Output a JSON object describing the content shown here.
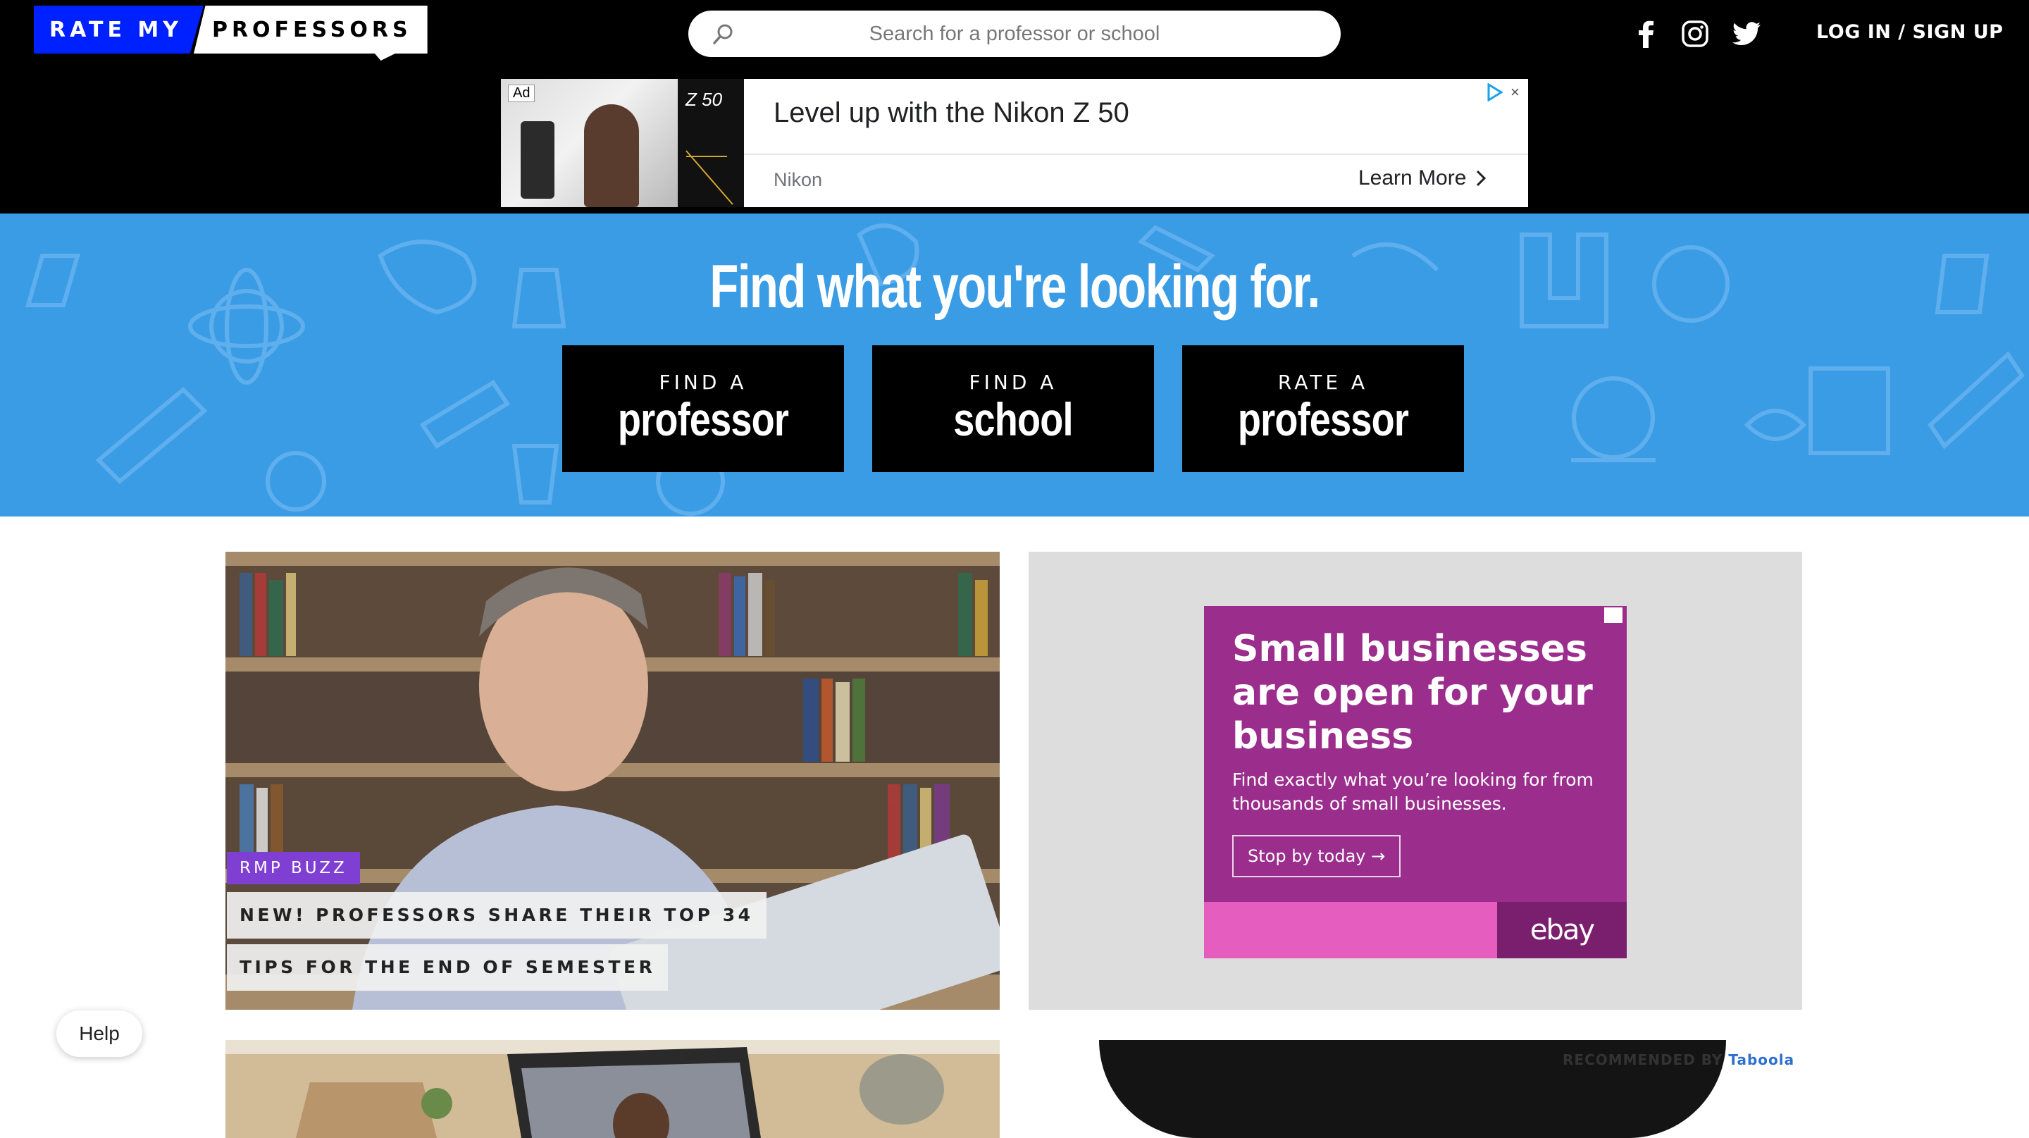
{
  "header": {
    "logo_left": "RATE MY",
    "logo_right": "PROFESSORS",
    "search_placeholder": "Search for a professor or school",
    "social_icons": [
      "facebook-icon",
      "instagram-icon",
      "twitter-icon"
    ],
    "login_label": "LOG IN / SIGN UP"
  },
  "top_ad": {
    "badge": "Ad",
    "product": "Z 50",
    "headline": "Level up with the Nikon Z 50",
    "brand": "Nikon",
    "cta": "Learn More",
    "close": "×"
  },
  "hero": {
    "title": "Find what you're looking for.",
    "buttons": [
      {
        "small": "FIND A",
        "big": "professor"
      },
      {
        "small": "FIND A",
        "big": "school"
      },
      {
        "small": "RATE A",
        "big": "professor"
      }
    ]
  },
  "feature": {
    "tag": "RMP BUZZ",
    "headline_line1": "NEW! PROFESSORS SHARE THEIR TOP 34",
    "headline_line2": "TIPS FOR THE END OF SEMESTER"
  },
  "side_ad": {
    "title": "Small businesses are open for your business",
    "subtitle": "Find exactly what you’re looking for from thousands of small businesses.",
    "cta": "Stop by today →",
    "brand": "ebay"
  },
  "recommended": {
    "label": "RECOMMENDED BY",
    "provider": "Taboola"
  },
  "help_label": "Help",
  "colors": {
    "header_bg": "#000000",
    "logo_blue": "#0021ff",
    "hero_blue": "#3b9ce6",
    "tag_purple": "#7f3fd2",
    "ebay_purple": "#9b2d8d"
  }
}
